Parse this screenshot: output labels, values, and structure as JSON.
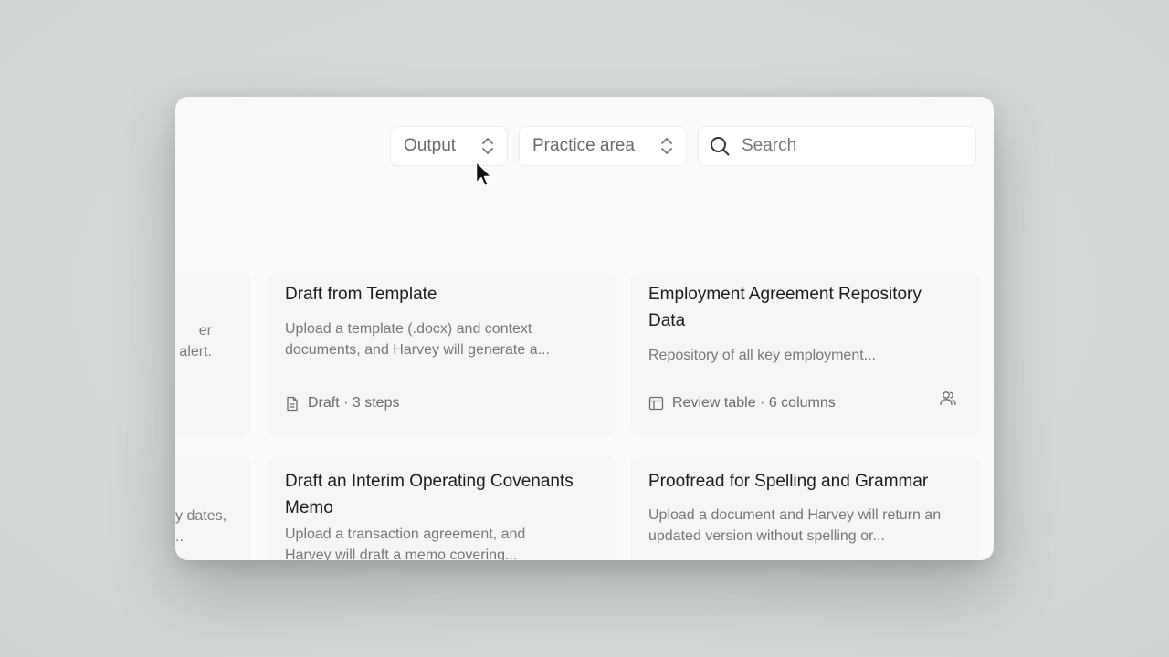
{
  "filters": {
    "output_label": "Output",
    "practice_area_label": "Practice area",
    "search_placeholder": "Search"
  },
  "left_edge": {
    "row1_line1": "er",
    "row1_line2": "alert.",
    "row2_line1": "y dates,",
    "row2_line2": ".."
  },
  "cards": [
    {
      "title": "Draft from Template",
      "description": "Upload a template (.docx) and context documents, and Harvey will generate a...",
      "meta": "Draft · 3 steps",
      "meta_icon": "document-icon"
    },
    {
      "title": "Employment Agreement Repository Data",
      "description": "Repository of all key employment...",
      "meta": "Review table · 6 columns",
      "meta_icon": "table-icon",
      "shared_icon": "users-icon"
    },
    {
      "title": "Draft an Interim Operating Covenants Memo",
      "description": "Upload a transaction agreement, and Harvey will draft a memo covering..."
    },
    {
      "title": "Proofread for Spelling and Grammar",
      "description": "Upload a document and Harvey will return an updated version without spelling or..."
    }
  ]
}
